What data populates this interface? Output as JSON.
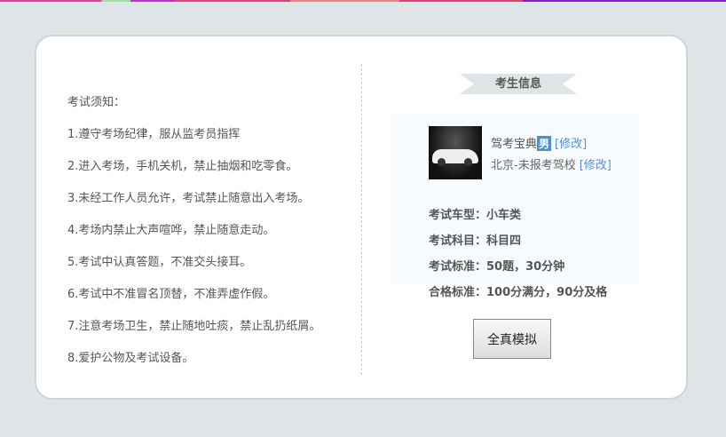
{
  "rules": {
    "title": "考试须知：",
    "items": [
      "1.遵守考场纪律，服从监考员指挥",
      "2.进入考场，手机关机，禁止抽烟和吃零食。",
      "3.未经工作人员允许，考试禁止随意出入考场。",
      "4.考场内禁止大声喧哗，禁止随意走动。",
      "5.考试中认真答题，不准交头接耳。",
      "6.考试中不准冒名顶替，不准弄虚作假。",
      "7.注意考场卫生，禁止随地吐痰，禁止乱扔纸屑。",
      "8.爱护公物及考试设备。"
    ]
  },
  "candidate": {
    "heading": "考生信息",
    "name": "驾考宝典",
    "gender": "男",
    "edit_label": "[修改]",
    "school": "北京-未报考驾校",
    "school_edit_label": "[修改]",
    "rows": [
      {
        "label": "考试车型：",
        "value": "小车类"
      },
      {
        "label": "考试科目：",
        "value": "科目四"
      },
      {
        "label": "考试标准：",
        "value": "50题，30分钟"
      },
      {
        "label": "合格标准：",
        "value": "100分满分，90分及格"
      }
    ]
  },
  "start_button": "全真模拟"
}
